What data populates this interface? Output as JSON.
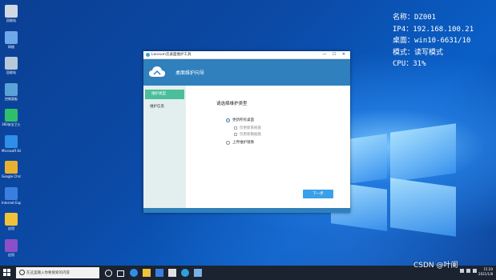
{
  "desktop_icons": [
    {
      "label": "回收站",
      "icon": "recycle-bin-icon",
      "color": "#cfd8e3"
    },
    {
      "label": "网络",
      "icon": "network-icon",
      "color": "#6fa8e8"
    },
    {
      "label": "回收站",
      "icon": "bin-icon",
      "color": "#b8c8d8"
    },
    {
      "label": "控制面板",
      "icon": "control-panel-icon",
      "color": "#5aa2d8"
    },
    {
      "label": "360安全卫士",
      "icon": "app-3-icon",
      "color": "#2fbf6a"
    },
    {
      "label": "Microsoft Edge",
      "icon": "edge-icon",
      "color": "#2f8fe8"
    },
    {
      "label": "Google Chrome",
      "icon": "chrome-icon",
      "color": "#e8b030"
    },
    {
      "label": "Internet Explorer",
      "icon": "ie-icon",
      "color": "#3a7fe0"
    },
    {
      "label": "应用",
      "icon": "app-yellow-icon",
      "color": "#f0c23a"
    },
    {
      "label": "应用",
      "icon": "app-purple-icon",
      "color": "#8a4fc8"
    }
  ],
  "overlay": {
    "name": "名称：DZ001",
    "ip": "IP4：192.168.100.21",
    "desktop": "桌面：win10-6631/10",
    "mode": "模式：读写模式",
    "cpu": "CPU：31%"
  },
  "window": {
    "title": "Lanxum云桌面维护工具",
    "header_title": "桌面维护向导",
    "controls": [
      "—",
      "☐",
      "✕"
    ],
    "sidebar": [
      {
        "label": "维护类型",
        "active": true
      },
      {
        "label": "维护信息",
        "active": false
      }
    ],
    "heading": "请选择维护类型",
    "options": [
      {
        "label": "更新所有桌面",
        "selected": true
      },
      {
        "label": "仅更新系统盘",
        "sub": true
      },
      {
        "label": "仅更新数据盘",
        "sub": true
      },
      {
        "label": "上传维护镜像",
        "selected": false
      }
    ],
    "next_button": "下一步"
  },
  "taskbar": {
    "search_placeholder": "在这里输入你要搜索的内容",
    "time": "15:20",
    "date": "2021/1/8"
  },
  "watermark": "CSDN @叶阑",
  "colors": {
    "accent": "#2f80bd",
    "sidebar_active": "#4bbf9a",
    "taskbar": "#1b2330"
  }
}
